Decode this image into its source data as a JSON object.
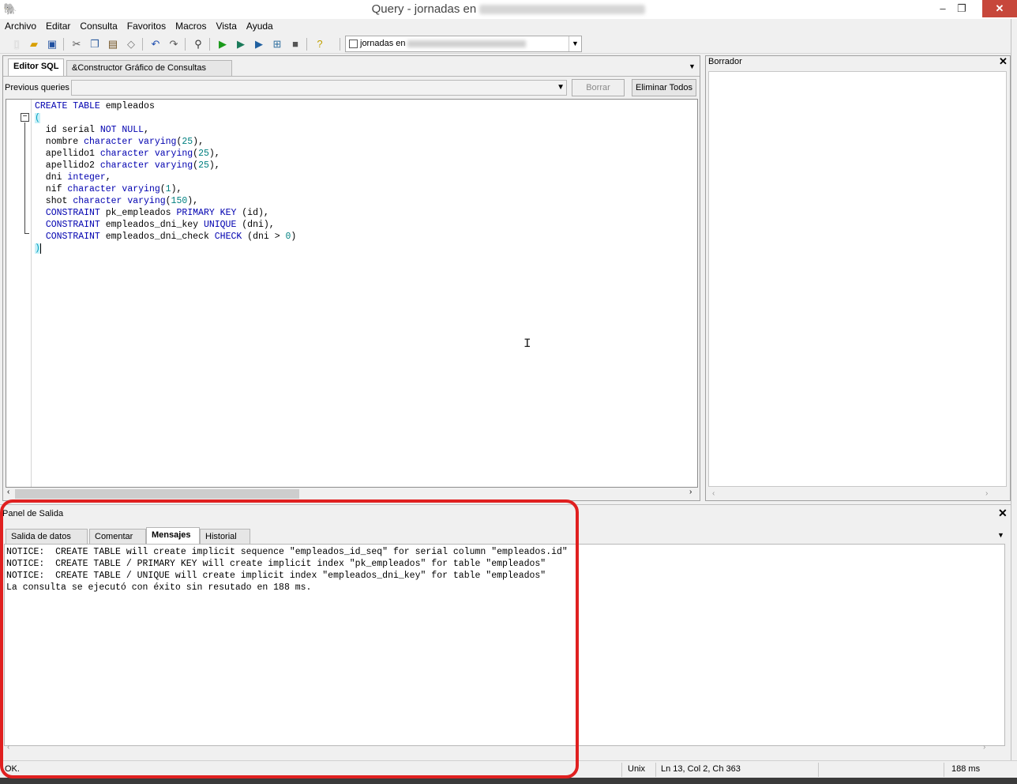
{
  "window": {
    "title": "Query - jornadas en",
    "minimize": "–",
    "restore": "❐",
    "close": "✕"
  },
  "menu": [
    "Archivo",
    "Editar",
    "Consulta",
    "Favoritos",
    "Macros",
    "Vista",
    "Ayuda"
  ],
  "toolbar": {
    "connection_label": "jornadas en"
  },
  "editor": {
    "tabs": [
      "Editor SQL",
      "&Constructor Gráfico de Consultas"
    ],
    "previous_label": "Previous queries",
    "borrar": "Borrar",
    "eliminar_todos": "Eliminar Todos",
    "code_lines": [
      "CREATE TABLE empleados",
      "(",
      "  id serial NOT NULL,",
      "  nombre character varying(25),",
      "  apellido1 character varying(25),",
      "  apellido2 character varying(25),",
      "  dni integer,",
      "  nif character varying(1),",
      "  shot character varying(150),",
      "  CONSTRAINT pk_empleados PRIMARY KEY (id),",
      "  CONSTRAINT empleados_dni_key UNIQUE (dni),",
      "  CONSTRAINT empleados_dni_check CHECK (dni > 0)",
      ")"
    ]
  },
  "borrador": {
    "title": "Borrador"
  },
  "output": {
    "title": "Panel de Salida",
    "tabs": [
      "Salida de datos",
      "Comentar",
      "Mensajes",
      "Historial"
    ],
    "messages": [
      "NOTICE:  CREATE TABLE will create implicit sequence \"empleados_id_seq\" for serial column \"empleados.id\"",
      "NOTICE:  CREATE TABLE / PRIMARY KEY will create implicit index \"pk_empleados\" for table \"empleados\"",
      "NOTICE:  CREATE TABLE / UNIQUE will create implicit index \"empleados_dni_key\" for table \"empleados\"",
      "La consulta se ejecutó con éxito sin resutado en 188 ms."
    ]
  },
  "status": {
    "state": "OK.",
    "encoding": "Unix",
    "position": "Ln 13, Col 2, Ch 363",
    "time": "188 ms"
  },
  "colors": {
    "accent_highlight": "#e02020",
    "keyword": "#0000b0",
    "number": "#008080"
  }
}
